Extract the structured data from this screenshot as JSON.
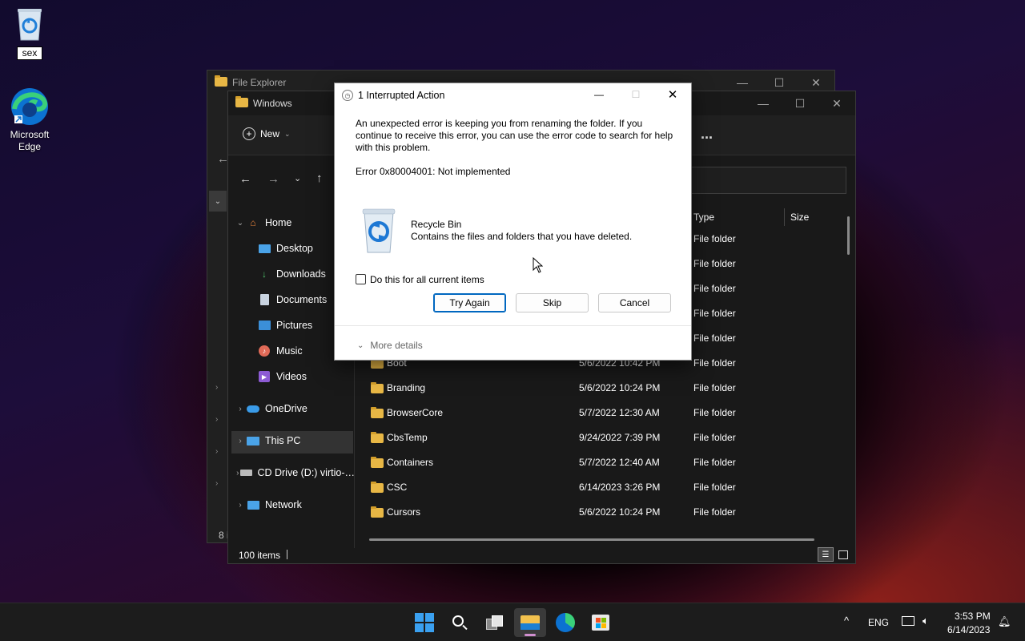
{
  "desktop": {
    "icons": [
      {
        "label": "sex",
        "icon": "recycle-bin-icon"
      },
      {
        "label": "Microsoft Edge",
        "icon": "edge-icon"
      }
    ]
  },
  "bg_window": {
    "title": "File Explorer",
    "status": "8 i"
  },
  "explorer": {
    "title": "Windows",
    "new_label": "New",
    "more_label": "...",
    "nav": {
      "home": "Home",
      "desktop": "Desktop",
      "downloads": "Downloads",
      "documents": "Documents",
      "pictures": "Pictures",
      "music": "Music",
      "videos": "Videos",
      "onedrive": "OneDrive",
      "thispc": "This PC",
      "cddrive": "CD Drive (D:) virtio-…",
      "network": "Network"
    },
    "columns": {
      "type": "Type",
      "size": "Size"
    },
    "type_only_rows": [
      "File folder",
      "File folder",
      "File folder",
      "File folder",
      "File folder"
    ],
    "rows": [
      {
        "name": "Boot",
        "date": "5/6/2022 10:42 PM",
        "type": "File folder"
      },
      {
        "name": "Branding",
        "date": "5/6/2022 10:24 PM",
        "type": "File folder"
      },
      {
        "name": "BrowserCore",
        "date": "5/7/2022 12:30 AM",
        "type": "File folder"
      },
      {
        "name": "CbsTemp",
        "date": "9/24/2022 7:39 PM",
        "type": "File folder"
      },
      {
        "name": "Containers",
        "date": "5/7/2022 12:40 AM",
        "type": "File folder"
      },
      {
        "name": "CSC",
        "date": "6/14/2023 3:26 PM",
        "type": "File folder"
      },
      {
        "name": "Cursors",
        "date": "5/6/2022 10:24 PM",
        "type": "File folder"
      }
    ],
    "status": "100 items"
  },
  "dialog": {
    "title": "1 Interrupted Action",
    "message": "An unexpected error is keeping you from renaming the folder. If you continue to receive this error, you can use the error code to search for help with this problem.",
    "error": "Error 0x80004001: Not implemented",
    "item_name": "Recycle Bin",
    "item_desc": "Contains the files and folders that you have deleted.",
    "checkbox_label": "Do this for all current items",
    "try_again": "Try Again",
    "skip": "Skip",
    "cancel": "Cancel",
    "more_details": "More details"
  },
  "taskbar": {
    "lang": "ENG",
    "time": "3:53 PM",
    "date": "6/14/2023"
  }
}
